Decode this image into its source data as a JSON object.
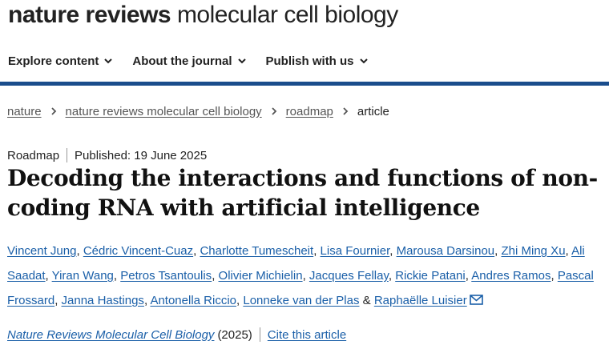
{
  "brand": {
    "bold": "nature reviews",
    "light": " molecular cell biology"
  },
  "nav": [
    {
      "label": "Explore content"
    },
    {
      "label": "About the journal"
    },
    {
      "label": "Publish with us"
    }
  ],
  "breadcrumb": {
    "items": [
      "nature",
      "nature reviews molecular cell biology",
      "roadmap"
    ],
    "current": "article"
  },
  "article": {
    "type": "Roadmap",
    "published": "Published: 19 June 2025",
    "title": "Decoding the interactions and functions of non-coding RNA with artificial intelligence",
    "authors": [
      "Vincent Jung",
      "Cédric Vincent-Cuaz",
      "Charlotte Tumescheit",
      "Lisa Fournier",
      "Marousa Darsinou",
      "Zhi Ming Xu",
      "Ali Saadat",
      "Yiran Wang",
      "Petros Tsantoulis",
      "Olivier Michielin",
      "Jacques Fellay",
      "Rickie Patani",
      "Andres Ramos",
      "Pascal Frossard",
      "Janna Hastings",
      "Antonella Riccio",
      "Lonneke van der Plas",
      "Raphaëlle Luisier"
    ],
    "author_sep": ", ",
    "author_last_sep": " & ",
    "journal": "Nature Reviews Molecular Cell Biology",
    "year": "(2025)",
    "cite_label": "Cite this article"
  },
  "icons": {
    "nav_chevron": "chevron-down-icon",
    "crumb_sep": "chevron-right-icon",
    "corresponding": "mail-icon"
  },
  "colors": {
    "link": "#1a5fa8",
    "nav_rule": "#1a4d8c",
    "text": "#222222"
  }
}
